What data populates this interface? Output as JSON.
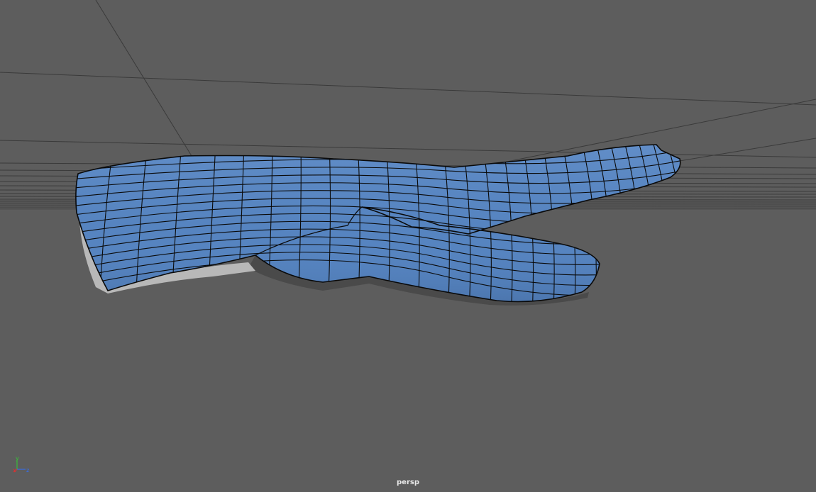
{
  "viewport": {
    "camera_label": "persp",
    "background_color": "#5d5d5d",
    "grid_color": "#3a3a3a",
    "mesh_fill_color": "#5684c0",
    "mesh_shadow_color": "#3f6497",
    "wire_color": "#0a0a0a",
    "object": "hand-mesh"
  },
  "axis_gizmo": {
    "y_label": "y",
    "x_label": "x",
    "z_label": "z",
    "y_color": "#33cc33",
    "x_color": "#e03030",
    "z_color": "#3070ff"
  }
}
